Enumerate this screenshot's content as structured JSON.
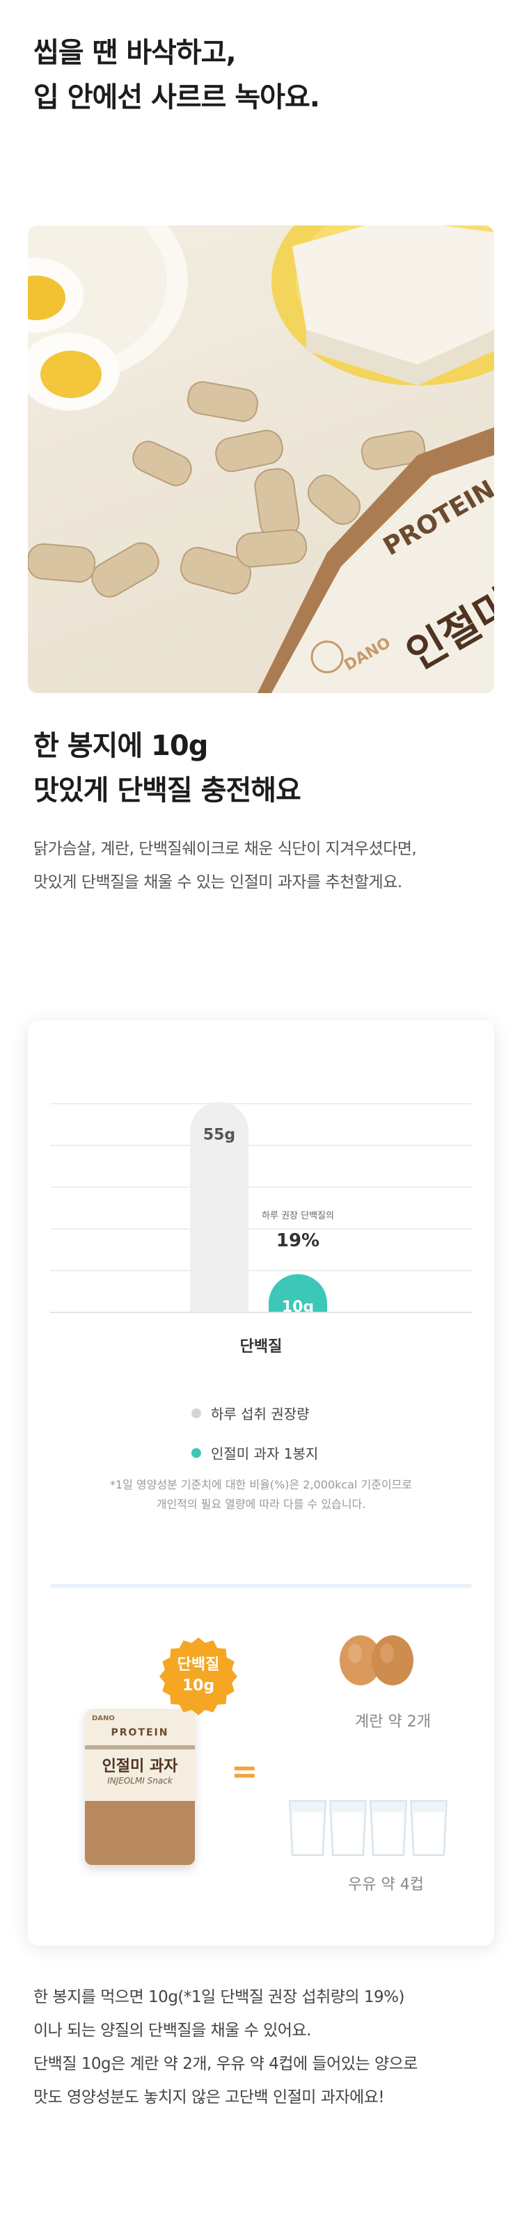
{
  "headline": {
    "line1": "씹을 땐 바삭하고,",
    "line2": "입 안에선 사르르 녹아요."
  },
  "photo": {
    "package_brand": "DANO",
    "package_title": "PROTEIN",
    "package_name": "인절미"
  },
  "section": {
    "title_line1": "한 봉지에 10g",
    "title_line2": "맛있게 단백질 충전해요",
    "desc_line1": "닭가슴살, 계란, 단백질쉐이크로 채운 식단이 지겨우셨다면,",
    "desc_line2": "맛있게 단백질을 채울 수 있는 인절미 과자를 추천할게요."
  },
  "chart_data": {
    "type": "bar",
    "categories": [
      "단백질"
    ],
    "series": [
      {
        "name": "하루 섭취 권장량",
        "values": [
          55
        ],
        "label": "55g",
        "color": "#efefef"
      },
      {
        "name": "인절미 과자 1봉지",
        "values": [
          10
        ],
        "label": "10g",
        "color": "#3cc7b9"
      }
    ],
    "annotation": {
      "caption": "하루 권장 단백질의",
      "value": "19%"
    },
    "unit": "g",
    "xlabel": "단백질",
    "ylim": [
      0,
      60
    ],
    "grid": true,
    "legend_placement": "bottom"
  },
  "footnote": {
    "line1": "*1일 영양성분 기준치에 대한 비율(%)은 2,000kcal 기준이므로",
    "line2": "개인적의 필요 열량에 따라 다를 수 있습니다."
  },
  "comparison": {
    "badge_line1": "단백질",
    "badge_line2": "10g",
    "badge_color": "#f5a623",
    "pouch_brand": "DANO",
    "pouch_protein": "PROTEIN",
    "pouch_name": "인절미 과자",
    "pouch_sub": "INJEOLMI Snack",
    "equals": "=",
    "egg_label": "계란 약 2개",
    "milk_label": "우유 약 4컵"
  },
  "bottom": {
    "line1": "한 봉지를 먹으면 10g(*1일 단백질 권장 섭취량의 19%)",
    "line2": "이나 되는 양질의 단백질을 채울 수 있어요.",
    "line3": "단백질 10g은 계란 약 2개, 우유 약 4컵에 들어있는 양으로",
    "line4": "맛도 영양성분도 놓치지 않은 고단백 인절미 과자에요!"
  }
}
